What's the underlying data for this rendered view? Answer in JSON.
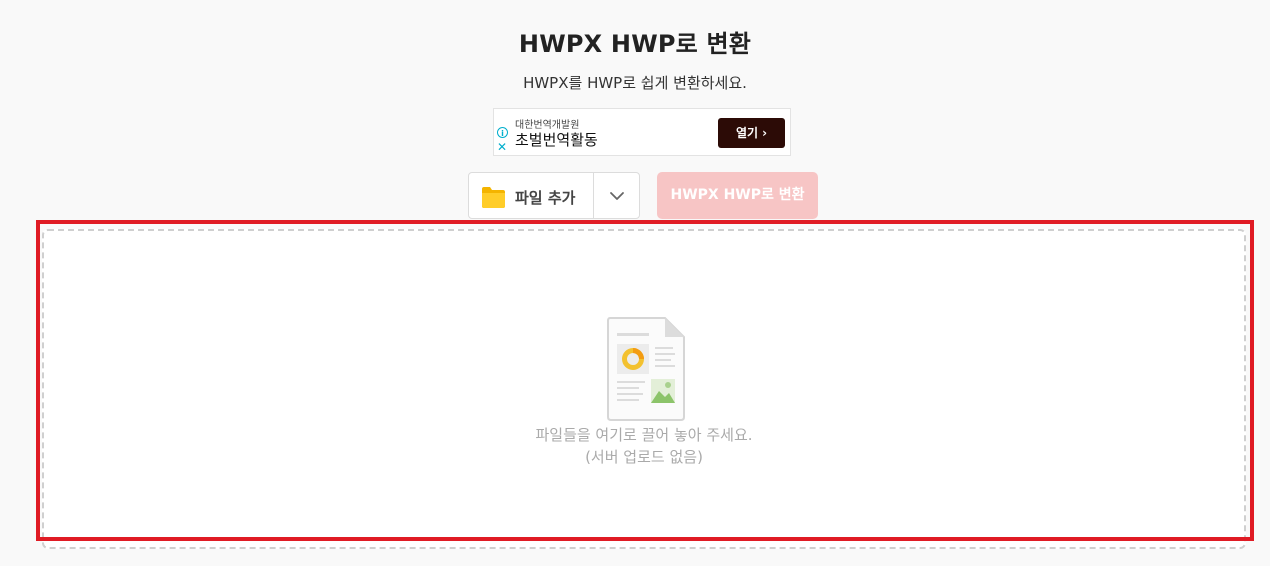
{
  "header": {
    "title": "HWPX HWP로 변환",
    "subtitle": "HWPX를 HWP로 쉽게 변환하세요."
  },
  "ad": {
    "advertiser": "대한번역개발원",
    "headline": "초벌번역활동",
    "cta_label": "열기",
    "info_icon": "info-icon",
    "close_icon": "close-icon",
    "cta_color": "#2c0b06",
    "info_color": "#00aecd"
  },
  "toolbar": {
    "add_file_label": "파일 추가",
    "add_file_icon": "folder-icon",
    "dropdown_icon": "chevron-down-icon",
    "convert_label": "HWPX HWP로 변환",
    "convert_enabled": false,
    "convert_color": "#f7c5c5",
    "folder_color": "#ffc107"
  },
  "dropzone": {
    "line1": "파일들을 여기로 끌어 놓아 주세요.",
    "line2": "(서버 업로드 없음)",
    "illustration_icon": "document-illustration-icon",
    "highlight_color": "#e01b24"
  }
}
